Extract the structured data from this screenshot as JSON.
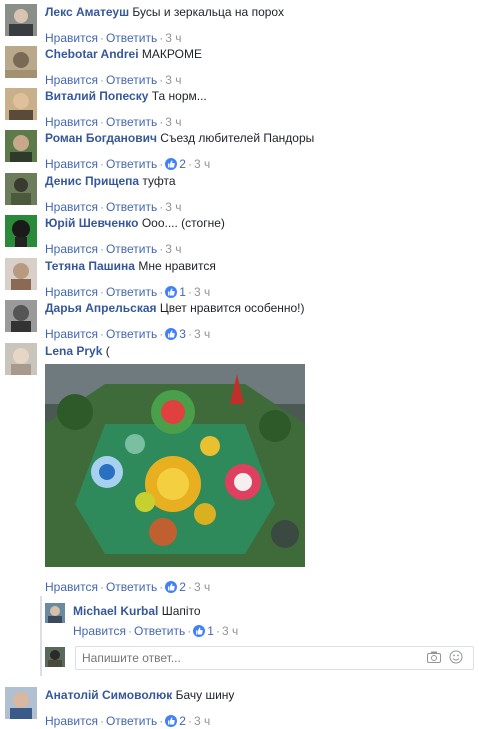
{
  "actions": {
    "like": "Нравится",
    "reply": "Ответить",
    "dot": "·"
  },
  "comments": [
    {
      "name": "Лекс Аматеуш",
      "text": "Бусы и зеркальца на порох",
      "time": "3 ч",
      "likes": ""
    },
    {
      "name": "Chebotar Andrei",
      "text": "МАКРОМЕ",
      "time": "3 ч",
      "likes": ""
    },
    {
      "name": "Виталий Попеску",
      "text": "Та норм...",
      "time": "3 ч",
      "likes": ""
    },
    {
      "name": "Роман Богданович",
      "text": "Съезд любителей Пандоры",
      "time": "3 ч",
      "likes": "2"
    },
    {
      "name": "Денис Прищепа",
      "text": "туфта",
      "time": "3 ч",
      "likes": ""
    },
    {
      "name": "Юрій Шевченко",
      "text": "Ооо.... (стогне)",
      "time": "3 ч",
      "likes": ""
    },
    {
      "name": "Тетяна Пашина",
      "text": "Мне нравится",
      "time": "3 ч",
      "likes": "1"
    },
    {
      "name": "Дарья Апрельская",
      "text": "Цвет нравится особенно!)",
      "time": "3 ч",
      "likes": "3"
    },
    {
      "name": "Lena Pryk",
      "text": "(",
      "time": "3 ч",
      "likes": "2"
    },
    {
      "name": "Анатолій Симоволюк",
      "text": "Бачу шину",
      "time": "3 ч",
      "likes": "2"
    }
  ],
  "reply": {
    "name": "Michael Kurbal",
    "text": "Шапіто",
    "time": "3 ч",
    "likes": "1"
  },
  "reply_input": {
    "placeholder": "Напишите ответ..."
  },
  "icons": {
    "like": "thumbs-up-icon",
    "camera": "camera-icon",
    "emoji": "smiley-icon"
  },
  "colors": {
    "link": "#365899",
    "action": "#4267b2",
    "meta": "#90949c",
    "like_badge": "#4080ff"
  }
}
